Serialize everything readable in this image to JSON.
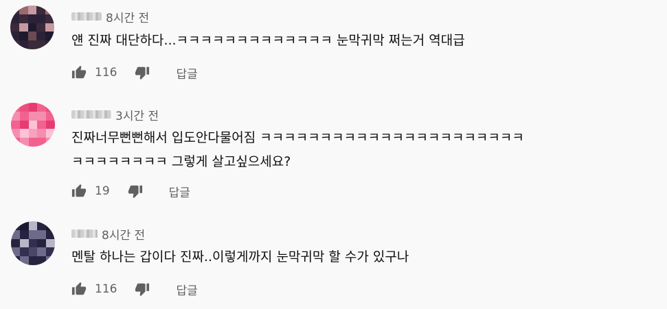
{
  "comments": [
    {
      "time": "8시간 전",
      "text_lines": [
        "얜 진짜 대단하다...ㅋㅋㅋㅋㅋㅋㅋㅋㅋㅋㅋㅋㅋ 눈막귀막 쩌는거 역대급"
      ],
      "likes": "116",
      "reply_label": "답글",
      "avatar_colors": [
        "#3a2a3a",
        "#6b4a52",
        "#9a6a6e",
        "#2c2238",
        "#c69aa0",
        "#1e1a2e"
      ]
    },
    {
      "time": "3시간 전",
      "text_lines": [
        "진짜너무뻔뻔해서 입도안다물어짐 ㅋㅋㅋㅋㅋㅋㅋㅋㅋㅋㅋㅋㅋㅋㅋㅋㅋㅋㅋㅋㅋㅋ",
        "ㅋㅋㅋㅋㅋㅋㅋㅋ 그렇게 살고싶으세요?"
      ],
      "likes": "19",
      "reply_label": "답글",
      "avatar_colors": [
        "#f2628f",
        "#f7a2bf",
        "#ee4d80",
        "#f58db0",
        "#e83a74",
        "#fbc3d5"
      ]
    },
    {
      "time": "8시간 전",
      "text_lines": [
        "멘탈 하나는 갑이다 진짜..이렇게까지 눈막귀막 할 수가 있구나"
      ],
      "likes": "116",
      "reply_label": "답글",
      "avatar_colors": [
        "#25233f",
        "#4a4766",
        "#191830",
        "#6e6b8a",
        "#b7b6c6",
        "#332f50"
      ]
    }
  ],
  "icons": {
    "like": "thumb-up-icon",
    "dislike": "thumb-down-icon"
  }
}
